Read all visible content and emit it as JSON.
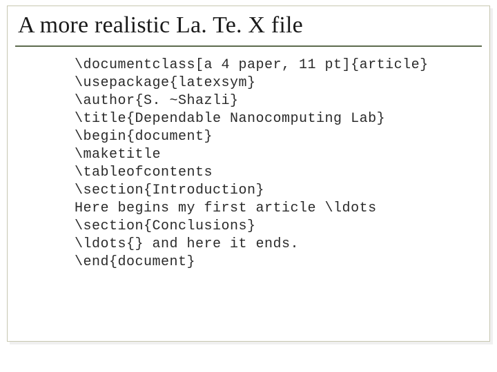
{
  "title": "A more realistic La. Te. X file",
  "code": {
    "l1": "\\documentclass[a 4 paper, 11 pt]{article}",
    "l2": "\\usepackage{latexsym}",
    "l3": "\\author{S. ~Shazli}",
    "l4": "\\title{Dependable Nanocomputing Lab}",
    "l5": "\\begin{document}",
    "l6": "\\maketitle",
    "l7": "\\tableofcontents",
    "l8": "\\section{Introduction}",
    "l9": "Here begins my first article \\ldots",
    "l10": "\\section{Conclusions}",
    "l11": "\\ldots{} and here it ends.",
    "l12": "\\end{document}"
  }
}
